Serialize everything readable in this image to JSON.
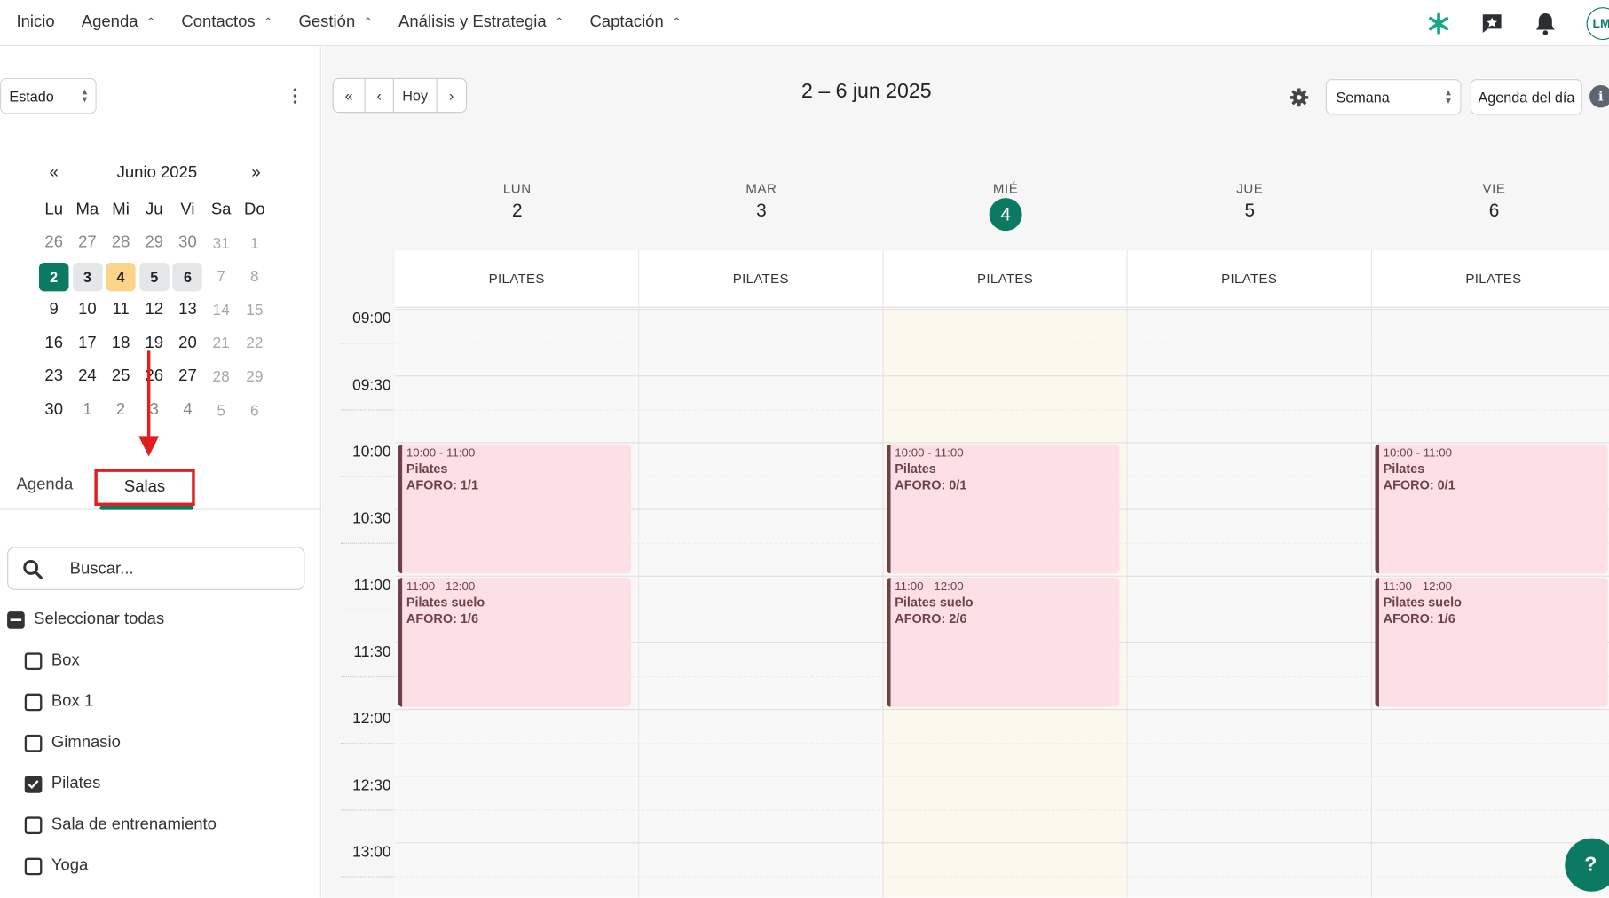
{
  "topnav": {
    "items": [
      {
        "label": "Inicio",
        "has_menu": false
      },
      {
        "label": "Agenda",
        "has_menu": true
      },
      {
        "label": "Contactos",
        "has_menu": true
      },
      {
        "label": "Gestión",
        "has_menu": true
      },
      {
        "label": "Análisis y Estrategia",
        "has_menu": true
      },
      {
        "label": "Captación",
        "has_menu": true
      }
    ],
    "right_icons": [
      "sparkle-icon",
      "star-chat-icon",
      "bell-icon"
    ],
    "avatar_initials": "LM"
  },
  "sidebar": {
    "estado_label": "Estado",
    "mini_calendar": {
      "prev": "«",
      "next": "»",
      "month_title": "Junio 2025",
      "weekdays": [
        "Lu",
        "Ma",
        "Mi",
        "Ju",
        "Vi",
        "Sa",
        "Do"
      ],
      "weeks": [
        [
          "26",
          "27",
          "28",
          "29",
          "30",
          "31",
          "1"
        ],
        [
          "2",
          "3",
          "4",
          "5",
          "6",
          "7",
          "8"
        ],
        [
          "9",
          "10",
          "11",
          "12",
          "13",
          "14",
          "15"
        ],
        [
          "16",
          "17",
          "18",
          "19",
          "20",
          "21",
          "22"
        ],
        [
          "23",
          "24",
          "25",
          "26",
          "27",
          "28",
          "29"
        ],
        [
          "30",
          "1",
          "2",
          "3",
          "4",
          "5",
          "6"
        ]
      ],
      "today": "2",
      "selected": "4"
    },
    "tabs": {
      "agenda": "Agenda",
      "salas": "Salas",
      "active": "Salas"
    },
    "search": {
      "placeholder": "Buscar..."
    },
    "select_all_label": "Seleccionar todas",
    "rooms": [
      {
        "label": "Box",
        "checked": false
      },
      {
        "label": "Box 1",
        "checked": false
      },
      {
        "label": "Gimnasio",
        "checked": false
      },
      {
        "label": "Pilates",
        "checked": true
      },
      {
        "label": "Sala de entrenamiento",
        "checked": false
      },
      {
        "label": "Yoga",
        "checked": false
      }
    ]
  },
  "calendar": {
    "nav": {
      "first": "«",
      "prev": "‹",
      "today": "Hoy",
      "next": "›"
    },
    "range_title": "2 – 6 jun 2025",
    "view_select": "Semana",
    "agenda_dia": "Agenda del día",
    "info_icon": "i",
    "days": [
      {
        "weekday": "LUN",
        "day": "2",
        "resource": "PILATES",
        "today": false
      },
      {
        "weekday": "MAR",
        "day": "3",
        "resource": "PILATES",
        "today": false
      },
      {
        "weekday": "MIÉ",
        "day": "4",
        "resource": "PILATES",
        "today": true
      },
      {
        "weekday": "JUE",
        "day": "5",
        "resource": "PILATES",
        "today": false
      },
      {
        "weekday": "VIE",
        "day": "6",
        "resource": "PILATES",
        "today": false
      }
    ],
    "times": [
      "09:00",
      "09:30",
      "10:00",
      "10:30",
      "11:00",
      "11:30",
      "12:00",
      "12:30",
      "13:00"
    ],
    "events": [
      {
        "day_index": 0,
        "start": "10:00",
        "end": "11:00",
        "time": "10:00 - 11:00",
        "name": "Pilates",
        "aforo": "AFORO: 1/1"
      },
      {
        "day_index": 0,
        "start": "11:00",
        "end": "12:00",
        "time": "11:00 - 12:00",
        "name": "Pilates suelo",
        "aforo": "AFORO: 1/6"
      },
      {
        "day_index": 2,
        "start": "10:00",
        "end": "11:00",
        "time": "10:00 - 11:00",
        "name": "Pilates",
        "aforo": "AFORO: 0/1"
      },
      {
        "day_index": 2,
        "start": "11:00",
        "end": "12:00",
        "time": "11:00 - 12:00",
        "name": "Pilates suelo",
        "aforo": "AFORO: 2/6"
      },
      {
        "day_index": 4,
        "start": "10:00",
        "end": "11:00",
        "time": "10:00 - 11:00",
        "name": "Pilates",
        "aforo": "AFORO: 0/1"
      },
      {
        "day_index": 4,
        "start": "11:00",
        "end": "12:00",
        "time": "11:00 - 12:00",
        "name": "Pilates suelo",
        "aforo": "AFORO: 1/6"
      }
    ]
  },
  "help_button": "?",
  "colors": {
    "brand": "#0c7a62",
    "event_bg": "#fde0e6",
    "event_border": "#6e4148",
    "highlight": "#e02020",
    "selected_day": "#fbd48a"
  }
}
